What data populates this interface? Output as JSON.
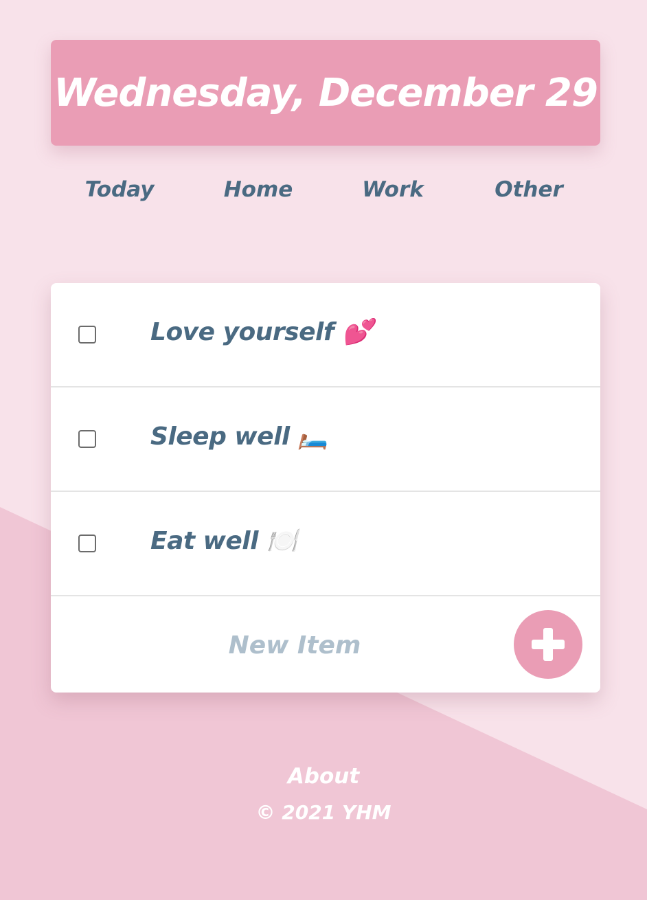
{
  "header": {
    "date": "Wednesday, December 29"
  },
  "nav": {
    "items": [
      {
        "label": "Today"
      },
      {
        "label": "Home"
      },
      {
        "label": "Work"
      },
      {
        "label": "Other"
      }
    ]
  },
  "todos": [
    {
      "text": "Love yourself 💕",
      "checked": false
    },
    {
      "text": "Sleep well 🛏️",
      "checked": false
    },
    {
      "text": "Eat well 🍽️",
      "checked": false
    }
  ],
  "new_item": {
    "placeholder": "New Item",
    "value": "",
    "add_icon": "plus-icon"
  },
  "footer": {
    "about": "About",
    "copyright": "© 2021 YHM"
  },
  "colors": {
    "background": "#f8e2ea",
    "background_shape": "#f0c6d5",
    "accent": "#ea9db5",
    "text": "#4a6a82",
    "placeholder": "#aebfcc"
  }
}
